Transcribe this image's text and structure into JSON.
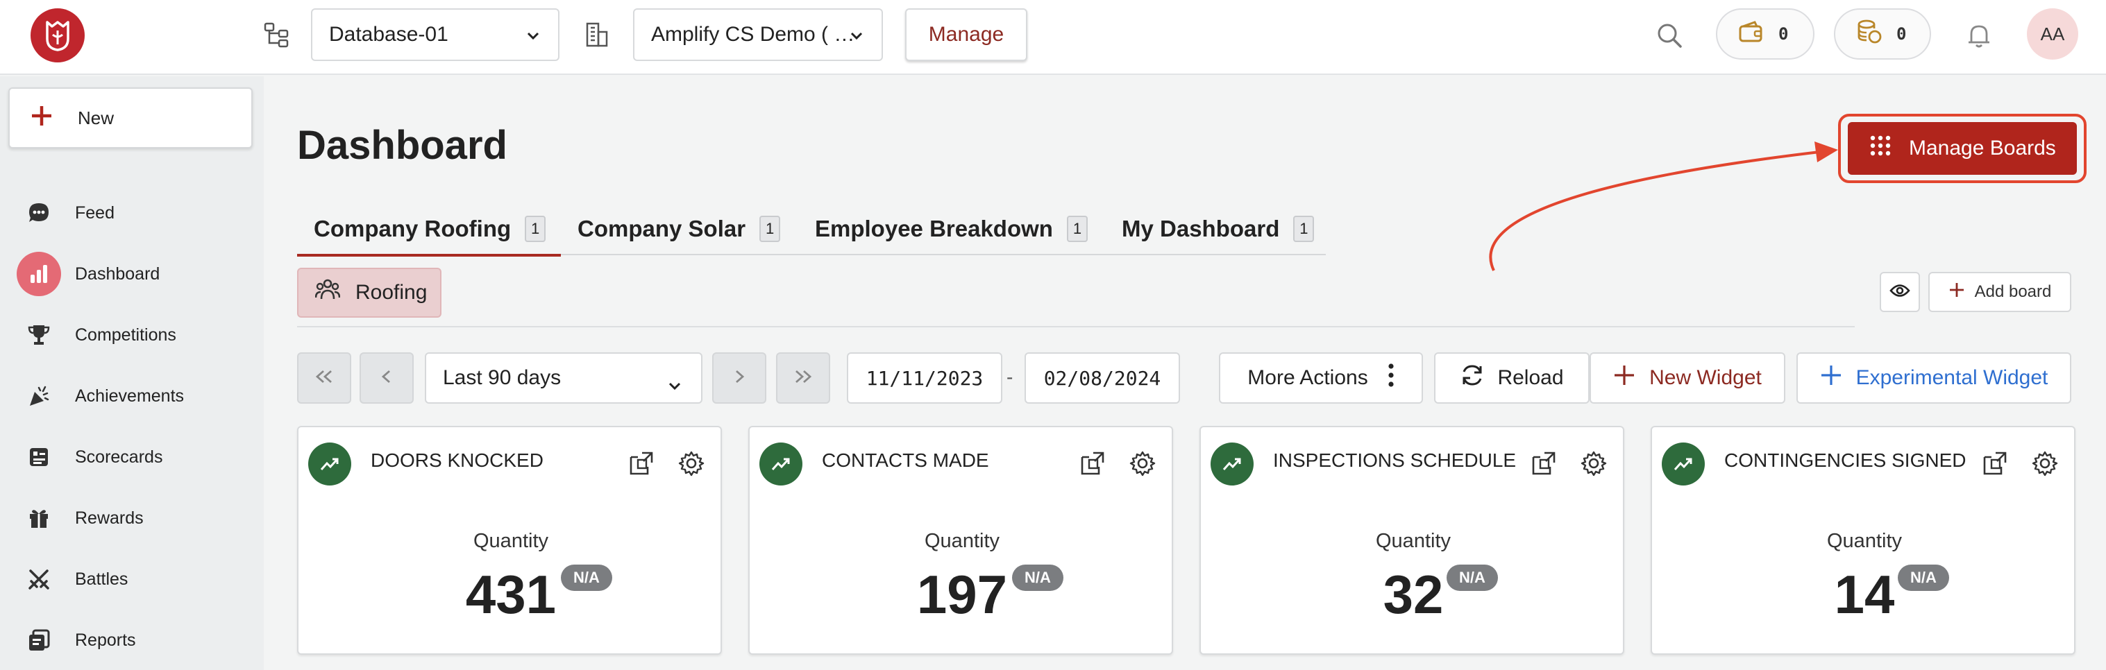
{
  "topbar": {
    "database_select": "Database-01",
    "company_select": "Amplify CS Demo ( …",
    "manage_label": "Manage",
    "wallet_count": "0",
    "coins_count": "0",
    "avatar_initials": "AA"
  },
  "sidebar": {
    "new_label": "New",
    "items": [
      {
        "label": "Feed",
        "icon": "chat-bubble-icon"
      },
      {
        "label": "Dashboard",
        "icon": "bar-chart-icon",
        "active": true
      },
      {
        "label": "Competitions",
        "icon": "trophy-icon"
      },
      {
        "label": "Achievements",
        "icon": "party-popper-icon"
      },
      {
        "label": "Scorecards",
        "icon": "scorecard-icon"
      },
      {
        "label": "Rewards",
        "icon": "gift-icon"
      },
      {
        "label": "Battles",
        "icon": "crossed-swords-icon"
      },
      {
        "label": "Reports",
        "icon": "reports-icon"
      }
    ]
  },
  "main": {
    "title": "Dashboard",
    "manage_boards_label": "Manage Boards",
    "tabs": [
      {
        "label": "Company Roofing",
        "count": "1",
        "active": true
      },
      {
        "label": "Company Solar",
        "count": "1"
      },
      {
        "label": "Employee Breakdown",
        "count": "1"
      },
      {
        "label": "My Dashboard",
        "count": "1"
      }
    ],
    "group_chip": "Roofing",
    "add_board_label": "Add board",
    "controls": {
      "range_select": "Last 90 days",
      "start_date": "11/11/2023",
      "date_separator": "-",
      "end_date": "02/08/2024",
      "more_actions": "More Actions",
      "reload": "Reload",
      "new_widget": "New Widget",
      "experimental_widget": "Experimental Widget"
    },
    "widgets": [
      {
        "title": "DOORS KNOCKED",
        "metric": "Quantity",
        "value": "431",
        "badge": "N/A"
      },
      {
        "title": "CONTACTS MADE",
        "metric": "Quantity",
        "value": "197",
        "badge": "N/A"
      },
      {
        "title": "INSPECTIONS SCHEDULED",
        "metric": "Quantity",
        "value": "32",
        "badge": "N/A"
      },
      {
        "title": "CONTINGENCIES SIGNED",
        "metric": "Quantity",
        "value": "14",
        "badge": "N/A"
      }
    ]
  },
  "colors": {
    "brand_red": "#b0251c",
    "annotation_orange": "#e2452e",
    "widget_icon_green": "#2e6b3c",
    "active_nav_pink": "#e46a75",
    "experimental_blue": "#2f6fd0"
  }
}
